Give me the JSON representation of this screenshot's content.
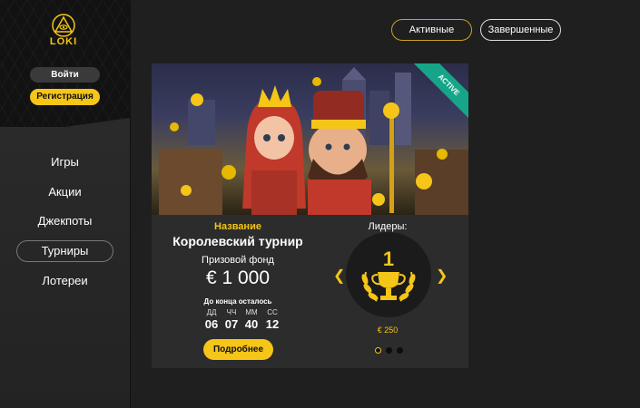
{
  "sidebar": {
    "logo_text": "LOKI",
    "login_label": "Войти",
    "register_label": "Регистрация",
    "menu": [
      {
        "label": "Игры",
        "active": false
      },
      {
        "label": "Акции",
        "active": false
      },
      {
        "label": "Джекпоты",
        "active": false
      },
      {
        "label": "Турниры",
        "active": true
      },
      {
        "label": "Лотереи",
        "active": false
      }
    ]
  },
  "filters": {
    "active_label": "Активные",
    "finished_label": "Завершенные"
  },
  "tournament": {
    "status_badge": "ACTIVE",
    "name_label": "Название",
    "name": "Королевский турнир",
    "prize_label": "Призовой фонд",
    "prize_value": "€ 1 000",
    "countdown_label": "До конца осталось",
    "countdown": [
      {
        "unit": "ДД",
        "value": "06"
      },
      {
        "unit": "ЧЧ",
        "value": "07"
      },
      {
        "unit": "ММ",
        "value": "40"
      },
      {
        "unit": "СС",
        "value": "12"
      }
    ],
    "details_label": "Подробнее",
    "leaders_label": "Лидеры:",
    "leader_rank": "1",
    "leader_prize": "€ 250",
    "slide_count": 3,
    "active_slide": 1
  },
  "colors": {
    "accent": "#f5c518",
    "badge": "#17a589",
    "background": "#1f1f1f"
  }
}
